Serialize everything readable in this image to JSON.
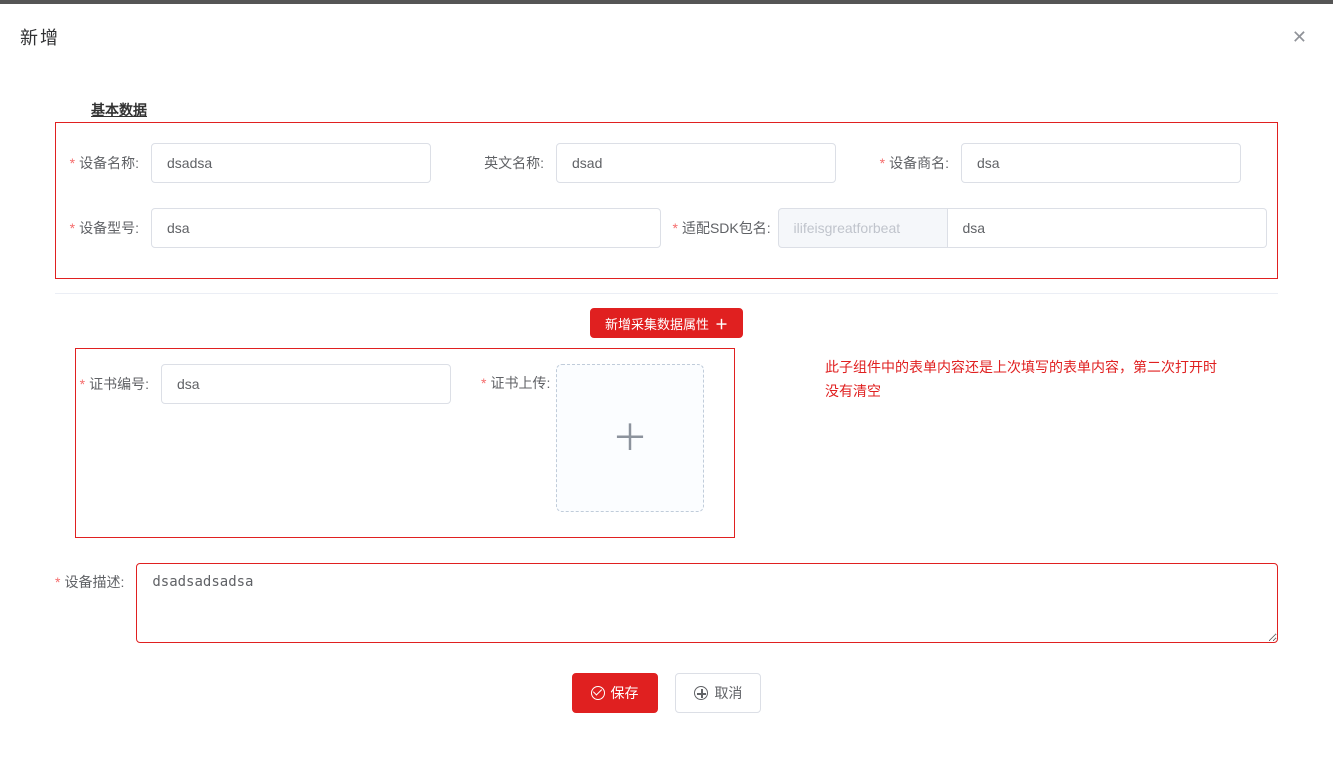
{
  "dialog": {
    "title": "新增"
  },
  "sections": {
    "basic_title": "基本数据"
  },
  "labels": {
    "device_name": "设备名称:",
    "english_name": "英文名称:",
    "vendor_name": "设备商名:",
    "device_model": "设备型号:",
    "sdk_package": "适配SDK包名:",
    "cert_no": "证书编号:",
    "cert_upload": "证书上传:",
    "device_desc": "设备描述:"
  },
  "values": {
    "device_name": "dsadsa",
    "english_name": "dsad",
    "vendor_name": "dsa",
    "device_model": "dsa",
    "sdk_prefix": "ilifeisgreatforbeat",
    "sdk_suffix": "dsa",
    "cert_no": "dsa",
    "device_desc": "dsadsadsadsa"
  },
  "buttons": {
    "add_attr": "新增采集数据属性",
    "save": "保存",
    "cancel": "取消"
  },
  "annotation": "此子组件中的表单内容还是上次填写的表单内容，第二次打开时没有清空"
}
